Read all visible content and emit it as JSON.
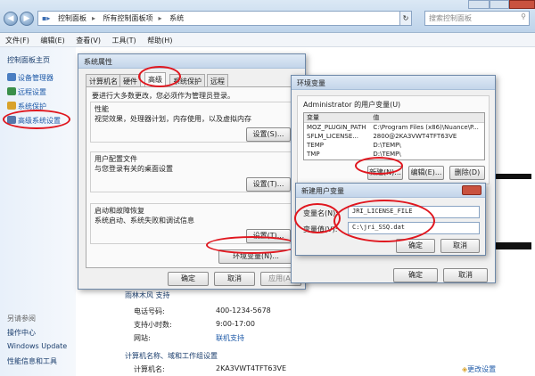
{
  "window": {
    "breadcrumbs": [
      "控制面板",
      "所有控制面板项",
      "系统"
    ],
    "search_placeholder": "搜索控制面板",
    "back_glyph": "◀",
    "forward_glyph": "▶"
  },
  "menu": [
    "文件(F)",
    "编辑(E)",
    "查看(V)",
    "工具(T)",
    "帮助(H)"
  ],
  "left_pane": {
    "home": "控制面板主页",
    "links": [
      {
        "label": "设备管理器",
        "color": "#4a7ec2"
      },
      {
        "label": "远程设置",
        "color": "#3a8f4a"
      },
      {
        "label": "系统保护",
        "color": "#d9a22a"
      },
      {
        "label": "高级系统设置",
        "color": "#5577aa"
      }
    ],
    "see_also": "另请参阅",
    "see_also_links": [
      "操作中心",
      "Windows Update",
      "性能信息和工具"
    ]
  },
  "sys_props": {
    "title": "系统属性",
    "tabs": [
      "计算机名",
      "硬件",
      "高级",
      "系统保护",
      "远程"
    ],
    "admin_note": "要进行大多数更改，您必须作为管理员登录。",
    "perf_title": "性能",
    "perf_desc": "视觉效果，处理器计划，内存使用，以及虚拟内存",
    "profile_title": "用户配置文件",
    "profile_desc": "与您登录有关的桌面设置",
    "startup_title": "启动和故障恢复",
    "startup_desc": "系统启动、系统失败和调试信息",
    "settings_btn": "设置(S)...",
    "settings_btn_t": "设置(T)...",
    "env_btn": "环境变量(N)...",
    "ok": "确定",
    "cancel": "取消",
    "apply": "应用(A)"
  },
  "env_vars": {
    "title": "环境变量",
    "user_vars_title": "Administrator 的用户变量(U)",
    "col_var": "变量",
    "col_val": "值",
    "rows": [
      [
        "MOZ_PLUGIN_PATH",
        "C:\\Program Files (x86)\\Nuance\\P..."
      ],
      [
        "SFLM_LICENSE...",
        "2800@2KA3VWT4TFT63VE"
      ],
      [
        "TEMP",
        "D:\\TEMP\\"
      ],
      [
        "TMP",
        "D:\\TEMP\\"
      ]
    ],
    "new_btn": "新建(N)...",
    "edit_btn": "编辑(E)...",
    "delete_btn": "删除(D)",
    "ok": "确定",
    "cancel": "取消"
  },
  "new_var": {
    "title": "新建用户变量",
    "name_label": "变量名(N):",
    "name_value": "JRI_LICENSE_FILE",
    "value_label": "变量值(V):",
    "value_value": "C:\\jri_SSQ.dat",
    "ok": "确定",
    "cancel": "取消"
  },
  "support": {
    "heading": "雨林木风 支持",
    "rows": [
      {
        "label": "电话号码:",
        "value": "400-1234-5678"
      },
      {
        "label": "支持小时数:",
        "value": "9:00-17:00"
      },
      {
        "label": "网站:",
        "value": "联机支持"
      }
    ],
    "domain_heading": "计算机名称、域和工作组设置",
    "computer_label": "计算机名:",
    "computer_value": "2KA3VWT4TFT63VE",
    "change_link": "更改设置"
  }
}
